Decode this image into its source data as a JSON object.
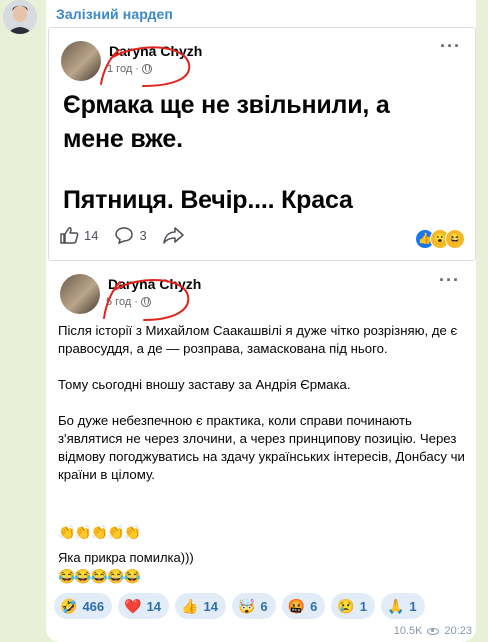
{
  "channel": {
    "name": "Залізний нардеп"
  },
  "post1": {
    "author": "Daryna Chyzh",
    "time": "1 год",
    "line1": "Єрмака ще не звільнили, а",
    "line2": "мене вже.",
    "line3": "Пятниця. Вечір.... Краса",
    "likes": "14",
    "comments": "3",
    "reaction_icons": [
      "like-icon",
      "wow-icon",
      "haha-icon"
    ]
  },
  "post2": {
    "author": "Daryna Chyzh",
    "time": "5 год",
    "paragraphs": [
      "Після історії з Михайлом Саакашвілі я дуже чітко розрізняю, де є правосуддя, а де — розправа, замаскована під нього.",
      "Тому сьогодні вношу заставу за Андрія Єрмака.",
      "Бо дуже небезпечною є практика, коли  справи починають з'являтися не через злочини, а через принципову позицію. Через відмову погоджуватись на здачу українських інтересів, Донбасу чи країни в цілому."
    ],
    "clap_row": "👏👏👏👏👏",
    "caption": "Яка прикра помилка)))",
    "laugh_row": "😂😂😂😂😂"
  },
  "reactions": [
    {
      "emoji": "🤣",
      "count": "466"
    },
    {
      "emoji": "❤️",
      "count": "14"
    },
    {
      "emoji": "👍",
      "count": "14"
    },
    {
      "emoji": "🤯",
      "count": "6"
    },
    {
      "emoji": "🤬",
      "count": "6"
    },
    {
      "emoji": "😢",
      "count": "1"
    },
    {
      "emoji": "🙏",
      "count": "1"
    }
  ],
  "footer": {
    "views": "10.5K",
    "time": "20:23"
  },
  "colors": {
    "chat_background": "#e8f1d8",
    "channel_name": "#3a88c8",
    "reaction_chip": "#e2ecf7",
    "reaction_text": "#2e6fa8",
    "annotation_red": "#e0241b"
  }
}
